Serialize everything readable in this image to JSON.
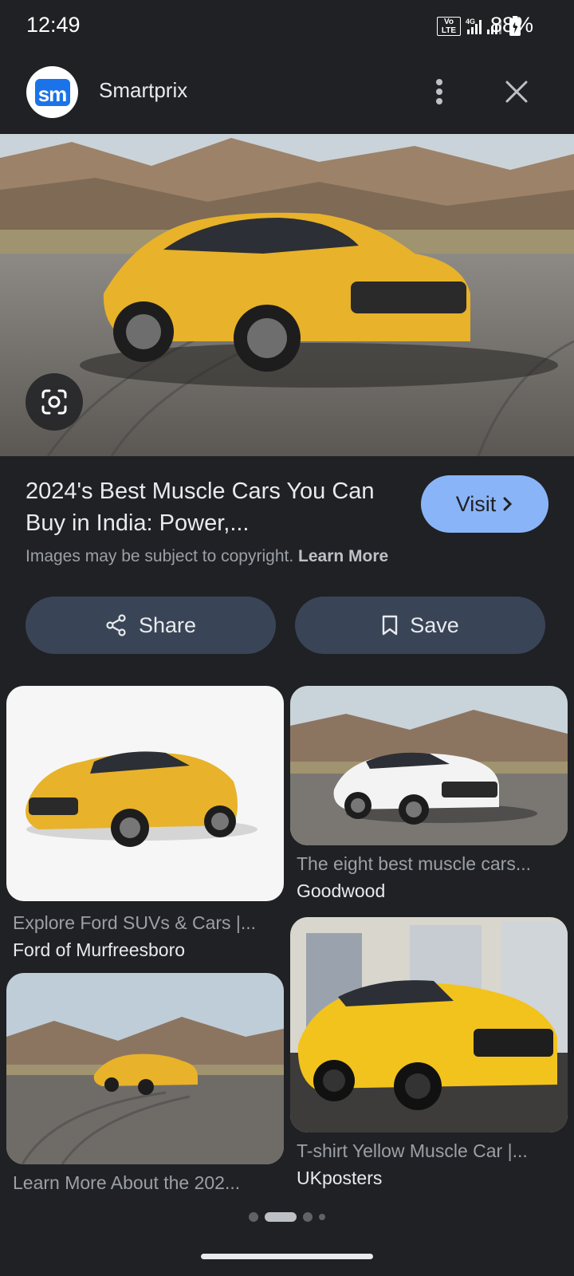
{
  "status_bar": {
    "time": "12:49",
    "network": "4G",
    "volte_label": "Vo LTE",
    "battery": "88%"
  },
  "header": {
    "site_logo_text": "sm",
    "site_name": "Smartprix"
  },
  "hero": {
    "image_icon": "yellow-muscle-car-photo"
  },
  "info": {
    "title": "2024's Best Muscle Cars You Can Buy in India: Power,...",
    "visit_label": "Visit",
    "copyright_text": "Images may be subject to copyright.",
    "learn_more": "Learn More"
  },
  "actions": {
    "share_label": "Share",
    "save_label": "Save"
  },
  "related": [
    {
      "title": "Explore Ford SUVs & Cars |...",
      "source": "Ford of Murfreesboro"
    },
    {
      "title": "The eight best muscle cars...",
      "source": "Goodwood"
    },
    {
      "title": "Learn More About the 202...",
      "source": ""
    },
    {
      "title": "T-shirt Yellow Muscle Car |...",
      "source": "UKposters"
    }
  ],
  "colors": {
    "background": "#202124",
    "accent": "#8ab4f8",
    "button_bg": "#394457",
    "car_yellow": "#e8b22a"
  }
}
